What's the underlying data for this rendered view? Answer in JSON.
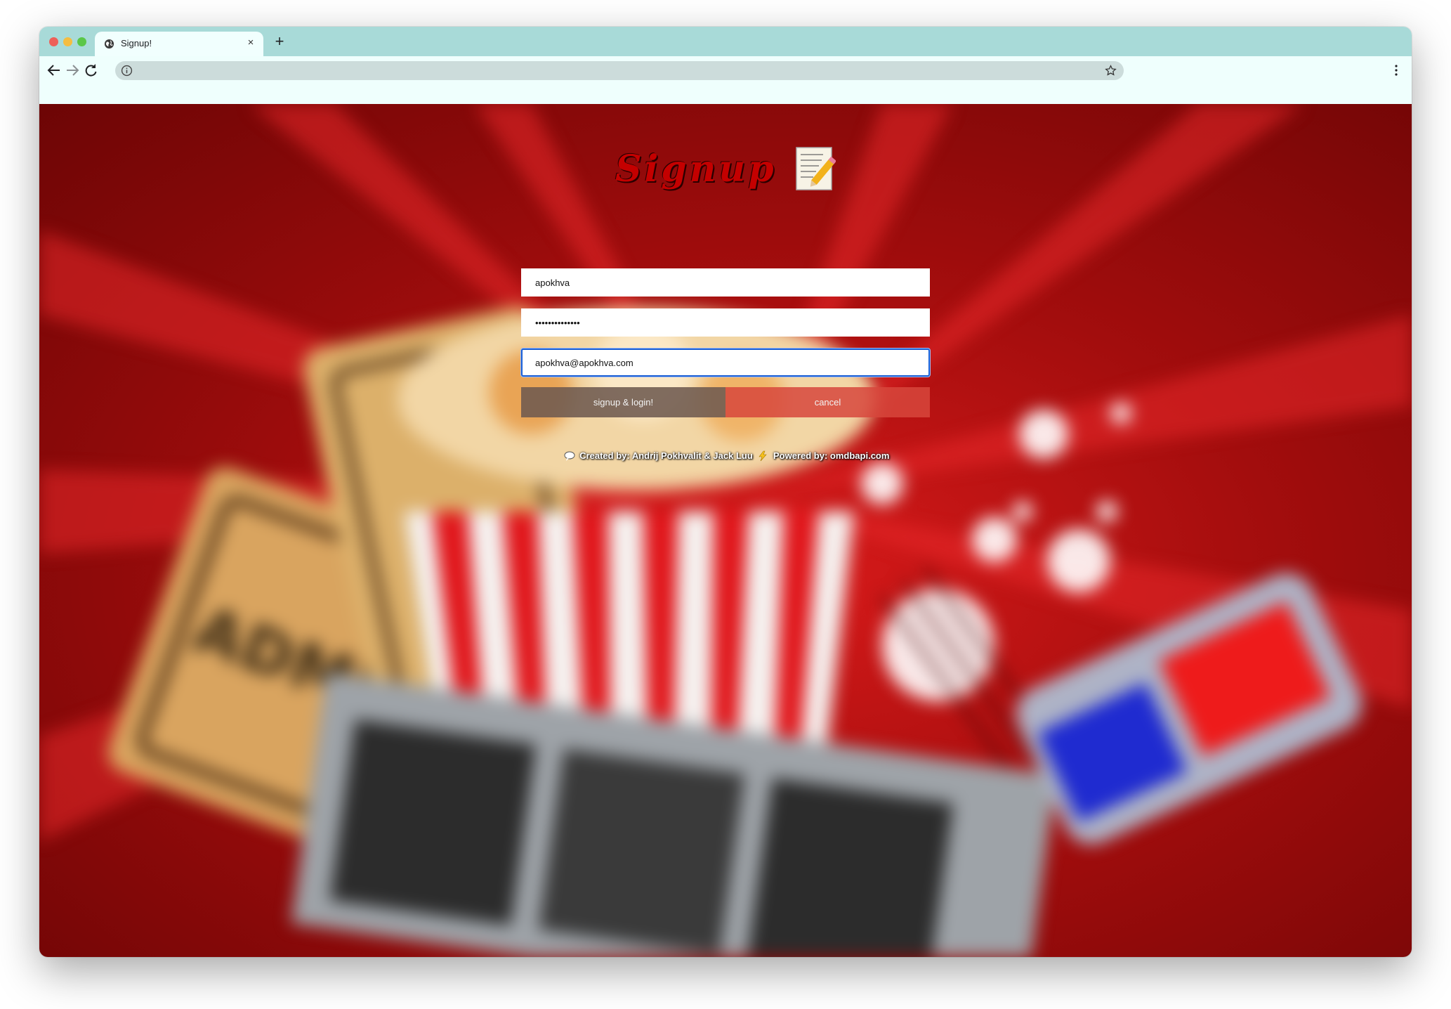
{
  "browser": {
    "tab_title": "Signup!",
    "new_tab_label": "+",
    "close_tab_label": "×",
    "address": ""
  },
  "page": {
    "heading": "Signup",
    "heading_icon": "memo-pencil-icon",
    "username_value": "apokhva",
    "password_value": "••••••••••••••",
    "email_value": "apokhva@apokhva.com",
    "signup_button": "signup & login!",
    "cancel_button": "cancel",
    "footer_created": "Created by: Andrij Pokhvalit & Jack Luu",
    "footer_powered": "Powered by: omdbapi.com"
  },
  "colors": {
    "tabbar": "#a8dad8",
    "toolbar": "#effffd",
    "background_red": "#d71a1a",
    "heading_red": "#c40000"
  }
}
